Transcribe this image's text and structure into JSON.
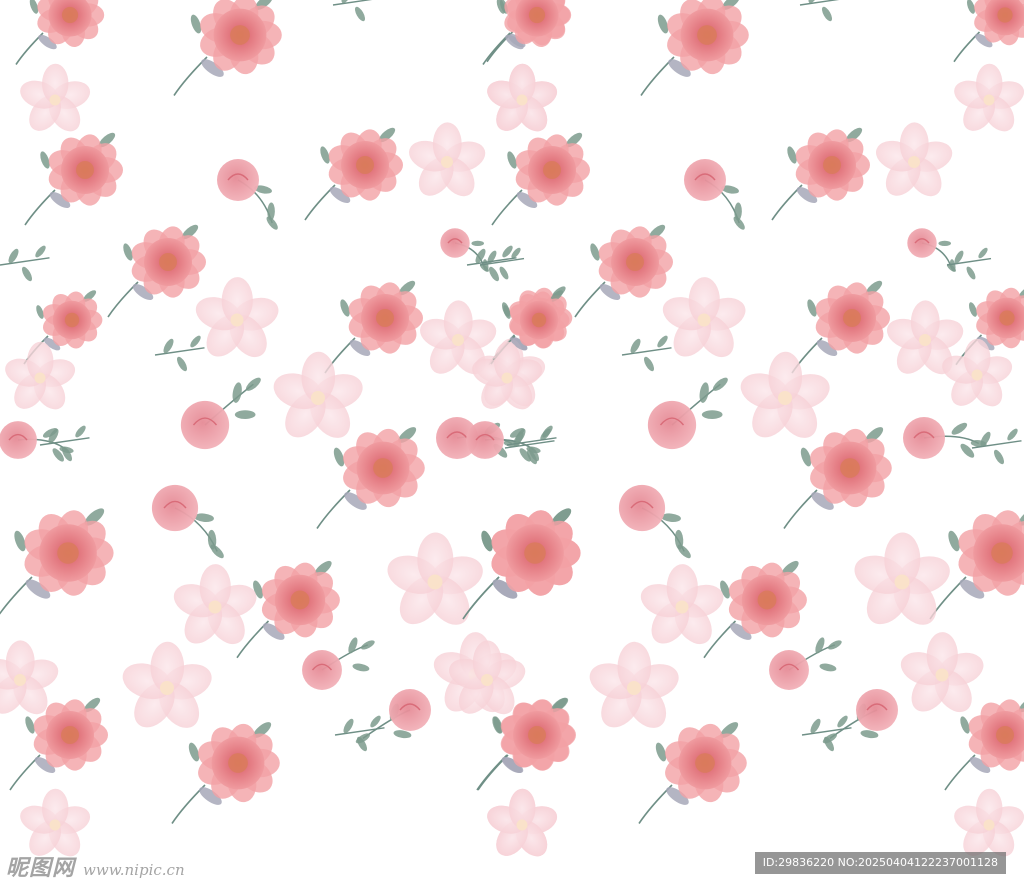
{
  "image": {
    "subject": "watercolor floral pattern",
    "colors": {
      "background": "#ffffff",
      "peony_outer": "#f2a1a5",
      "peony_inner": "#e1747c",
      "peony_center": "#d97a5a",
      "bud": "#e58a95",
      "pale_petal": "#f8d5da",
      "leaf": "#7c9b8d",
      "dusky_leaf": "#a7a8b8",
      "stem": "#6f8f86"
    },
    "motifs": [
      "peony-icon",
      "rosebud-icon",
      "pale-blossom-icon",
      "leaf-sprig-icon"
    ]
  },
  "watermark": {
    "logo_text": "昵图网",
    "url_text": "www.nipic.cn"
  },
  "id_bar": {
    "text": "ID:29836220 NO:20250404122237001128"
  }
}
